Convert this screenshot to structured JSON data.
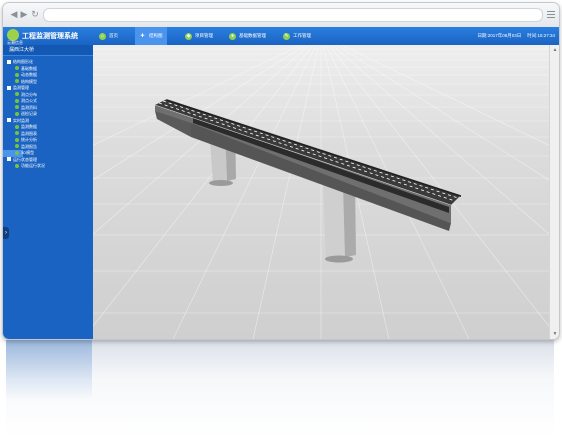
{
  "app": {
    "company": "云瀚信息",
    "title": "工程监测管理系统"
  },
  "menu": [
    {
      "label": "首页",
      "active": false
    },
    {
      "label": "结构图",
      "active": true
    },
    {
      "label": "项目管理",
      "active": false
    },
    {
      "label": "基础数据管理",
      "active": false
    },
    {
      "label": "工作管理",
      "active": false
    }
  ],
  "status": {
    "date": "日期:2017年08月03日",
    "time": "时间:15:27:34"
  },
  "sidebar": {
    "title": "漏西江大桥",
    "tree": [
      {
        "label": "结构图形化",
        "level": 1
      },
      {
        "label": "基础数据",
        "level": 2
      },
      {
        "label": "动态数据",
        "level": 2
      },
      {
        "label": "结构模型",
        "level": 2
      },
      {
        "label": "监测管理",
        "level": 1
      },
      {
        "label": "测点分布",
        "level": 2
      },
      {
        "label": "测点公式",
        "level": 2
      },
      {
        "label": "监测资料",
        "level": 2
      },
      {
        "label": "巡检记录",
        "level": 2
      },
      {
        "label": "实时监测",
        "level": 1
      },
      {
        "label": "监测数据",
        "level": 2
      },
      {
        "label": "监测图表",
        "level": 2
      },
      {
        "label": "统计分析",
        "level": 2
      },
      {
        "label": "监测报告",
        "level": 2
      },
      {
        "label": "3D模型",
        "level": 2,
        "selected": true
      },
      {
        "label": "运行状态管理",
        "level": 1
      },
      {
        "label": "功能运行状况",
        "level": 2
      }
    ]
  },
  "colors": {
    "brand_blue": "#1a63c2",
    "active_tab": "#4a94ee",
    "accent_green": "#8fd14f"
  }
}
